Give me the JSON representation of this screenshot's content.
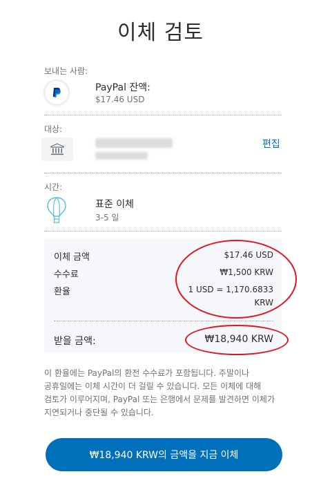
{
  "page": {
    "title": "이체 검토"
  },
  "sender": {
    "label": "보내는 사람:",
    "name": "PayPal 잔액:",
    "amount": "$17.46 USD",
    "icon": "paypal-logo-icon"
  },
  "recipient": {
    "label": "대상:",
    "icon": "bank-icon",
    "edit_label": "편집"
  },
  "timing": {
    "label": "시간:",
    "name": "표준 이체",
    "duration": "3-5 일",
    "icon": "hot-air-balloon-icon"
  },
  "summary": {
    "rows": [
      {
        "label": "이체 금액",
        "value": "$17.46 USD"
      },
      {
        "label": "수수료",
        "value": "₩1,500 KRW"
      },
      {
        "label": "환율",
        "value_line1": "1 USD = 1,170.6833",
        "value_line2": "KRW"
      }
    ],
    "receive_label": "받을 금액:",
    "receive_value": "₩18,940 KRW"
  },
  "note": "이 환율에는 PayPal의 환전 수수료가 포함됩니다. 주말이나 공휴일에는 이체 시간이 더 걸릴 수 있습니다. 모든 이체에 대해 검토가 이루어지며, PayPal 또는 은행에서 문제를 발견하면 이체가 지연되거나 중단될 수 있습니다.",
  "cta": {
    "label": "₩18,940 KRW의 금액을 지금 이체"
  },
  "colors": {
    "accent": "#0070ba",
    "annotation": "#e0141e",
    "summary_bg": "#f5f7fa"
  }
}
